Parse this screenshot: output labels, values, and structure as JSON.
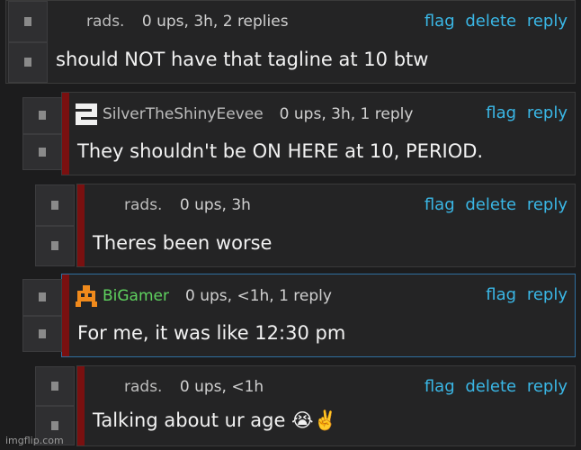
{
  "comments": [
    {
      "user": "rads.",
      "meta": "0 ups, 3h, 2 replies",
      "actions": [
        "flag",
        "delete",
        "reply"
      ],
      "text": "should NOT have that tagline at 10 btw"
    },
    {
      "user": "SilverTheShinyEevee",
      "meta": "0 ups, 3h, 1 reply",
      "actions": [
        "flag",
        "reply"
      ],
      "text": "They shouldn't be ON HERE at 10, PERIOD.",
      "avatar": "silver-s-logo-icon"
    },
    {
      "user": "rads.",
      "meta": "0 ups, 3h",
      "actions": [
        "flag",
        "delete",
        "reply"
      ],
      "text": "Theres been worse"
    },
    {
      "user": "BiGamer",
      "meta": "0 ups, <1h, 1 reply",
      "actions": [
        "flag",
        "reply"
      ],
      "text": "For me, it was like 12:30 pm",
      "avatar": "orange-robot-icon",
      "user_color": "#5fd35f"
    },
    {
      "user": "rads.",
      "meta": "0 ups, <1h",
      "actions": [
        "flag",
        "delete",
        "reply"
      ],
      "text": "Talking about ur age 😭✌️"
    }
  ],
  "watermark": "imgflip.com",
  "colors": {
    "link": "#3ab7e6",
    "background": "#1c1c1d",
    "panel": "#242425",
    "accent_red": "#7a1010",
    "highlight_border": "#2f6f9f"
  }
}
